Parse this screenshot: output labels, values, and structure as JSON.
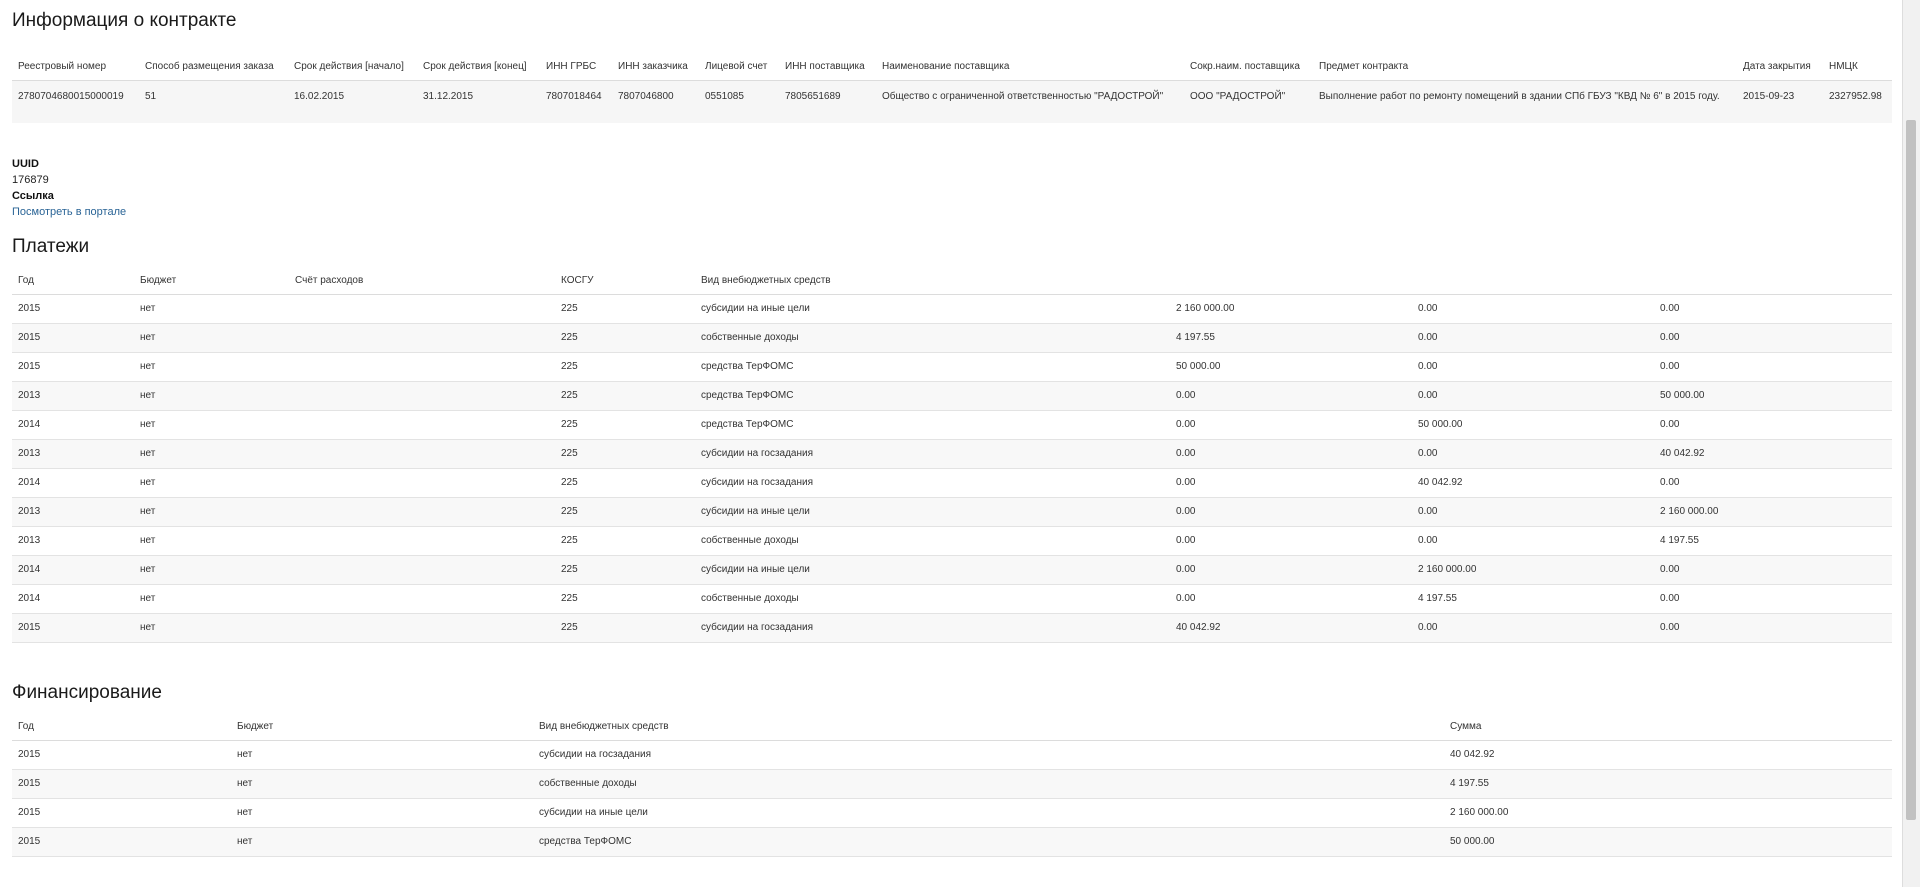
{
  "contract": {
    "title": "Информация о контракте",
    "headers": [
      "Реестровый номер",
      "Способ размещения заказа",
      "Срок действия [начало]",
      "Срок действия [конец]",
      "ИНН ГРБС",
      "ИНН заказчика",
      "Лицевой счет",
      "ИНН поставщика",
      "Наименование поставщика",
      "Сокр.наим. поставщика",
      "Предмет контракта",
      "Дата закрытия",
      "НМЦК"
    ],
    "row": [
      "2780704680015000019",
      "51",
      "16.02.2015",
      "31.12.2015",
      "7807018464",
      "7807046800",
      "0551085",
      "7805651689",
      "Общество с ограниченной ответственностью \"РАДОСТРОЙ\"",
      "ООО \"РАДОСТРОЙ\"",
      "Выполнение работ по ремонту помещений в здании СПб ГБУЗ \"КВД № 6\" в 2015 году.",
      "2015-09-23",
      "2327952.98"
    ]
  },
  "meta": {
    "uuid_label": "UUID",
    "uuid_value": "176879",
    "link_label": "Ссылка",
    "link_text": "Посмотреть в портале"
  },
  "payments": {
    "title": "Платежи",
    "headers": [
      "Год",
      "Бюджет",
      "Счёт расходов",
      "КОСГУ",
      "Вид внебюджетных средств",
      "",
      "",
      ""
    ],
    "rows": [
      [
        "2015",
        "нет",
        "",
        "225",
        "субсидии на иные цели",
        "2 160 000.00",
        "0.00",
        "0.00"
      ],
      [
        "2015",
        "нет",
        "",
        "225",
        "собственные доходы",
        "4 197.55",
        "0.00",
        "0.00"
      ],
      [
        "2015",
        "нет",
        "",
        "225",
        "средства ТерФОМС",
        "50 000.00",
        "0.00",
        "0.00"
      ],
      [
        "2013",
        "нет",
        "",
        "225",
        "средства ТерФОМС",
        "0.00",
        "0.00",
        "50 000.00"
      ],
      [
        "2014",
        "нет",
        "",
        "225",
        "средства ТерФОМС",
        "0.00",
        "50 000.00",
        "0.00"
      ],
      [
        "2013",
        "нет",
        "",
        "225",
        "субсидии на госзадания",
        "0.00",
        "0.00",
        "40 042.92"
      ],
      [
        "2014",
        "нет",
        "",
        "225",
        "субсидии на госзадания",
        "0.00",
        "40 042.92",
        "0.00"
      ],
      [
        "2013",
        "нет",
        "",
        "225",
        "субсидии на иные цели",
        "0.00",
        "0.00",
        "2 160 000.00"
      ],
      [
        "2013",
        "нет",
        "",
        "225",
        "собственные доходы",
        "0.00",
        "0.00",
        "4 197.55"
      ],
      [
        "2014",
        "нет",
        "",
        "225",
        "субсидии на иные цели",
        "0.00",
        "2 160 000.00",
        "0.00"
      ],
      [
        "2014",
        "нет",
        "",
        "225",
        "собственные доходы",
        "0.00",
        "4 197.55",
        "0.00"
      ],
      [
        "2015",
        "нет",
        "",
        "225",
        "субсидии на госзадания",
        "40 042.92",
        "0.00",
        "0.00"
      ]
    ]
  },
  "funding": {
    "title": "Финансирование",
    "headers": [
      "Год",
      "Бюджет",
      "Вид внебюджетных средств",
      "Сумма"
    ],
    "rows": [
      [
        "2015",
        "нет",
        "субсидии на госзадания",
        "40 042.92"
      ],
      [
        "2015",
        "нет",
        "собственные доходы",
        "4 197.55"
      ],
      [
        "2015",
        "нет",
        "субсидии на иные цели",
        "2 160 000.00"
      ],
      [
        "2015",
        "нет",
        "средства ТерФОМС",
        "50 000.00"
      ]
    ]
  }
}
